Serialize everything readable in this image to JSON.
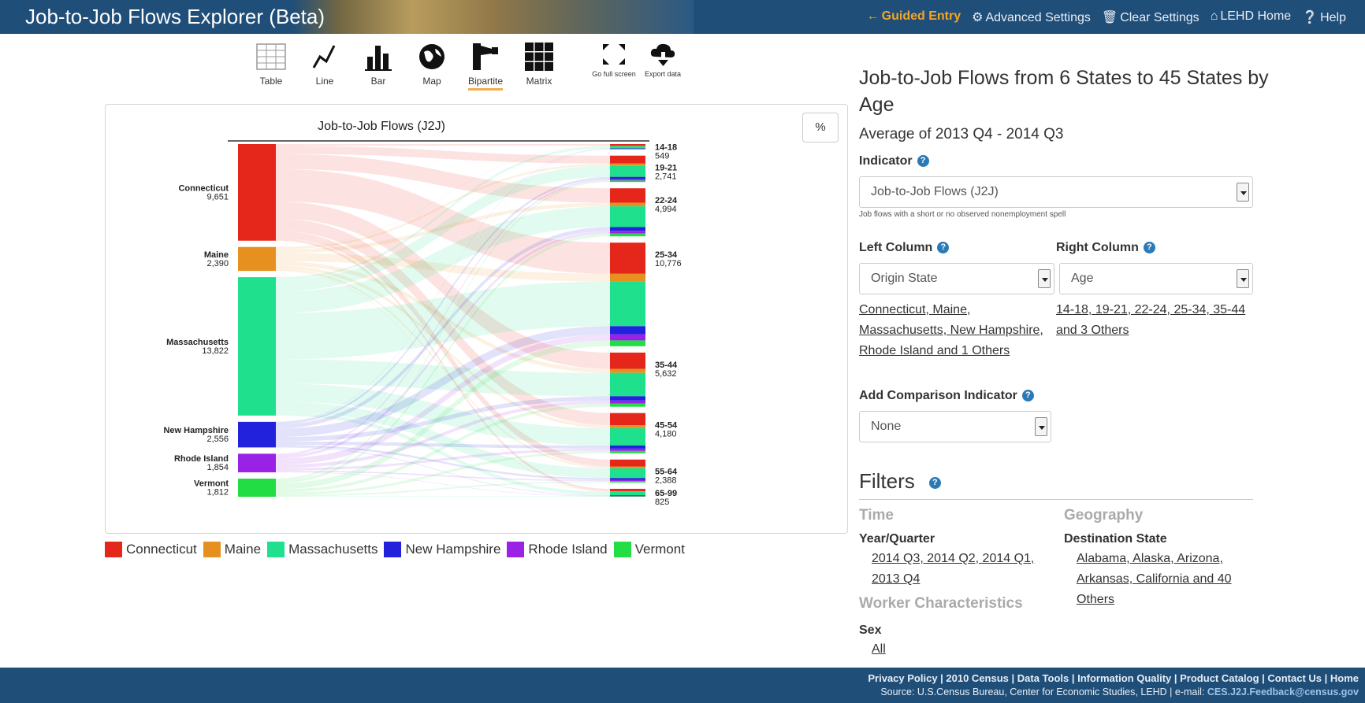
{
  "header": {
    "title": "Job-to-Job Flows Explorer (Beta)",
    "nav": [
      {
        "icon": "arrow-left-icon",
        "label": "Guided Entry",
        "active": true
      },
      {
        "icon": "gear-icon",
        "label": "Advanced Settings",
        "active": false
      },
      {
        "icon": "trash-icon",
        "label": "Clear Settings",
        "active": false
      },
      {
        "icon": "home-icon",
        "label": "LEHD Home",
        "active": false
      },
      {
        "icon": "question-circle-icon",
        "label": "Help",
        "active": false
      }
    ]
  },
  "toolbar": {
    "views": [
      {
        "icon": "table-icon",
        "label": "Table"
      },
      {
        "icon": "line-chart-icon",
        "label": "Line"
      },
      {
        "icon": "bar-chart-icon",
        "label": "Bar"
      },
      {
        "icon": "globe-icon",
        "label": "Map"
      },
      {
        "icon": "bipartite-icon",
        "label": "Bipartite",
        "active": true
      },
      {
        "icon": "matrix-icon",
        "label": "Matrix"
      }
    ],
    "actions": [
      {
        "icon": "fullscreen-icon",
        "label": "Go full screen"
      },
      {
        "icon": "cloud-download-icon",
        "label": "Export data"
      }
    ]
  },
  "percent_button": "%",
  "chart_data": {
    "type": "bipartite",
    "title": "Job-to-Job Flows (J2J)",
    "left": [
      {
        "name": "Connecticut",
        "value": "9,651",
        "color": "#e5261a"
      },
      {
        "name": "Maine",
        "value": "2,390",
        "color": "#e6901f"
      },
      {
        "name": "Massachusetts",
        "value": "13,822",
        "color": "#1fe08c"
      },
      {
        "name": "New Hampshire",
        "value": "2,556",
        "color": "#2222dd"
      },
      {
        "name": "Rhode Island",
        "value": "1,854",
        "color": "#9a22e6"
      },
      {
        "name": "Vermont",
        "value": "1,812",
        "color": "#22dd44"
      }
    ],
    "right": [
      {
        "name": "14-18",
        "value": "549"
      },
      {
        "name": "19-21",
        "value": "2,741"
      },
      {
        "name": "22-24",
        "value": "4,994"
      },
      {
        "name": "25-34",
        "value": "10,776"
      },
      {
        "name": "35-44",
        "value": "5,632"
      },
      {
        "name": "45-54",
        "value": "4,180"
      },
      {
        "name": "55-64",
        "value": "2,388"
      },
      {
        "name": "65-99",
        "value": "825"
      }
    ]
  },
  "legend": [
    "Connecticut",
    "Maine",
    "Massachusetts",
    "New Hampshire",
    "Rhode Island",
    "Vermont"
  ],
  "panel": {
    "heading": "Job-to-Job Flows from 6 States to 45 States by Age",
    "subtitle": "Average of 2013 Q4 - 2014 Q3",
    "indicator_label": "Indicator",
    "indicator_value": "Job-to-Job Flows (J2J)",
    "indicator_hint": "Job flows with a short or no observed nonemployment spell",
    "left_column_label": "Left Column",
    "left_column_value": "Origin State",
    "left_column_link": "Connecticut, Maine, Massachusetts, New Hampshire, Rhode Island and 1 Others",
    "right_column_label": "Right Column",
    "right_column_value": "Age",
    "right_column_link": "14-18, 19-21, 22-24, 25-34, 35-44 and 3 Others",
    "comparison_label": "Add Comparison Indicator",
    "comparison_value": "None",
    "filters_heading": "Filters",
    "time_heading": "Time",
    "year_quarter_label": "Year/Quarter",
    "year_quarter_link": "2014 Q3, 2014 Q2, 2014 Q1, 2013 Q4",
    "worker_heading": "Worker Characteristics",
    "sex_label": "Sex",
    "sex_link": "All",
    "geography_heading": "Geography",
    "destination_label": "Destination State",
    "destination_link": "Alabama, Alaska, Arizona, Arkansas, California and 40 Others"
  },
  "footer": {
    "links": "Privacy Policy | 2010 Census | Data Tools | Information Quality | Product Catalog | Contact Us | Home",
    "source": "Source: U.S.Census Bureau, Center for Economic Studies, LEHD   |   e-mail:",
    "email": "CES.J2J.Feedback@census.gov"
  }
}
